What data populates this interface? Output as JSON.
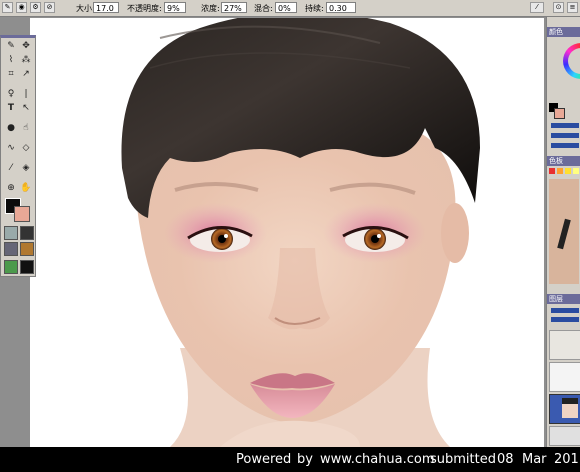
{
  "options_bar": {
    "size_label": "大小:",
    "size_value": "17.0",
    "opacity_label": "不透明度:",
    "opacity_value": "9%",
    "density_label": "浓度:",
    "density_value": "27%",
    "blend_label": "混合:",
    "blend_value": "0%",
    "persist_label": "持续:",
    "persist_value": "0.30"
  },
  "right_panel": {
    "color_header": "颜色",
    "swatches_header": "色板",
    "layers_header": "图层"
  },
  "caption": {
    "powered": "Powered",
    "by": "by",
    "site": "www.chahua.com",
    "submitted": "submitted",
    "day": "08",
    "month": "Mar",
    "year": "201"
  },
  "colors": {
    "foreground": "#0c0c0c",
    "background": "#e8a896",
    "ui_gray": "#d4d0c8",
    "workspace_gray": "#8e8e8e"
  },
  "icons": [
    "brush-icon",
    "move-icon",
    "lasso-icon",
    "wand-icon",
    "crop-icon",
    "text-icon",
    "pen-icon",
    "hand-icon",
    "zoom-icon",
    "eyedropper-icon",
    "eraser-icon",
    "smudge-icon"
  ]
}
